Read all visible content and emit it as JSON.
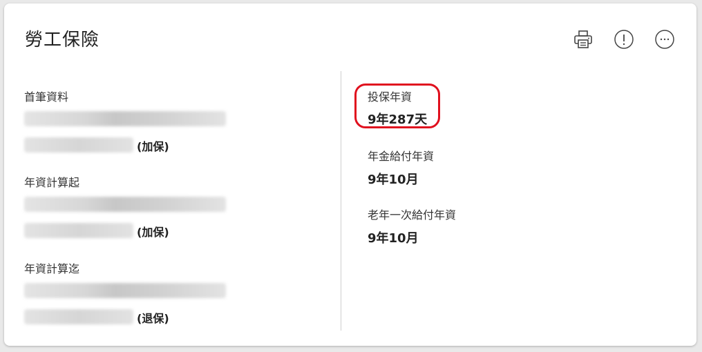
{
  "card": {
    "title": "勞工保險",
    "actions": [
      {
        "name": "print-icon"
      },
      {
        "name": "info-icon"
      },
      {
        "name": "more-icon"
      }
    ]
  },
  "left": {
    "first_record": {
      "label": "首筆資料",
      "status": "(加保)"
    },
    "seniority_start": {
      "label": "年資計算起",
      "status": "(加保)"
    },
    "seniority_end": {
      "label": "年資計算迄",
      "status": "(退保)"
    }
  },
  "right": {
    "insured_years": {
      "label": "投保年資",
      "value": "9年287天"
    },
    "pension_years": {
      "label": "年金給付年資",
      "value": "9年10月"
    },
    "lump_sum_years": {
      "label": "老年一次給付年資",
      "value": "9年10月"
    }
  },
  "colors": {
    "highlight": "#e0101e",
    "background": "#ffffff"
  }
}
